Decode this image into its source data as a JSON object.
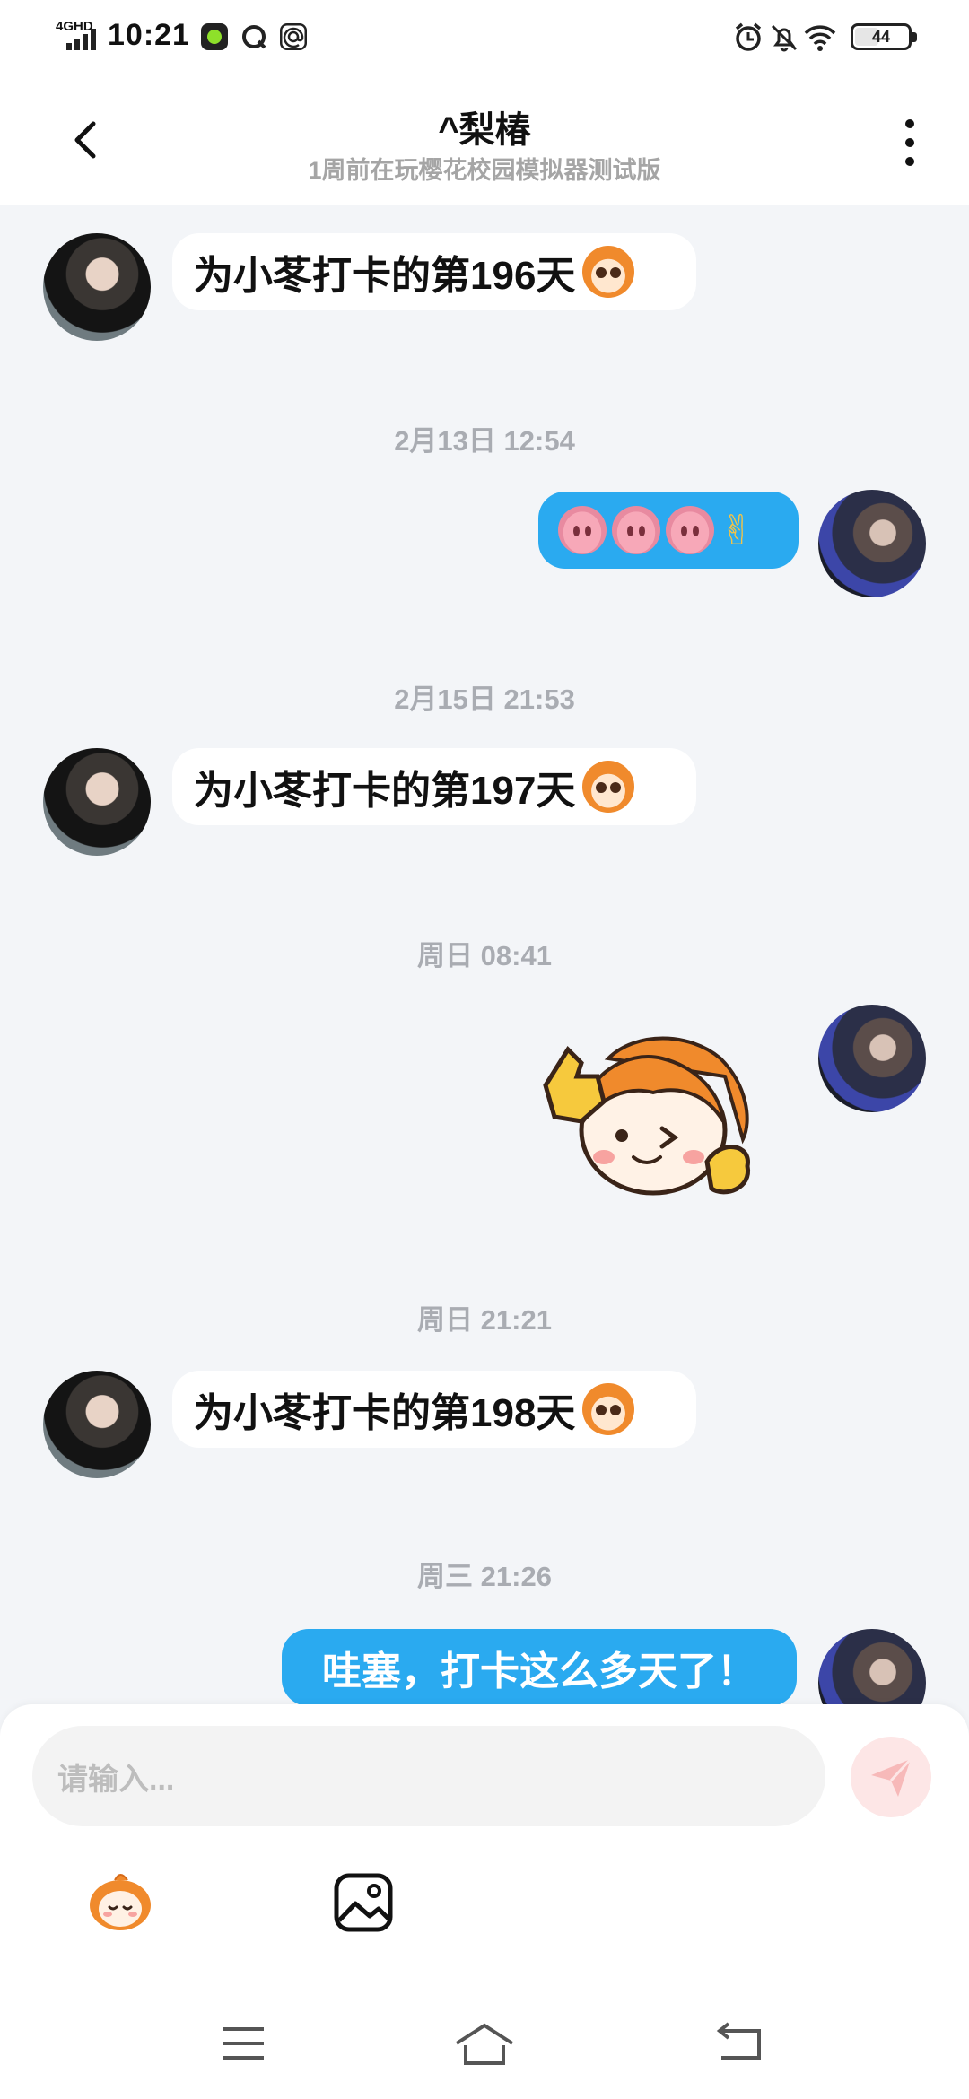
{
  "status_bar": {
    "network": "4GHD",
    "time": "10:21",
    "battery": "44",
    "battery_level": 0.44,
    "icons": [
      "app-green-icon",
      "browser-q-icon",
      "at-sign-icon",
      "alarm-icon",
      "mute-bell-icon",
      "wifi-icon",
      "battery-icon"
    ]
  },
  "header": {
    "title": "^梨椿",
    "subtitle": "1周前在玩樱花校园模拟器测试版",
    "back_icon": "chevron-left-icon",
    "more_icon": "more-vertical-icon"
  },
  "messages": [
    {
      "type": "text",
      "side": "in",
      "text": "为小苳打卡的第196天",
      "emoji": "monkey-face-emoji"
    },
    {
      "type": "timestamp",
      "text": "2月13日 12:54"
    },
    {
      "type": "emoji",
      "side": "out",
      "emojis": [
        "pig-nose-emoji",
        "pig-nose-emoji",
        "pig-nose-emoji",
        "victory-hand-emoji"
      ]
    },
    {
      "type": "timestamp",
      "text": "2月15日 21:53"
    },
    {
      "type": "text",
      "side": "in",
      "text": "为小苳打卡的第197天",
      "emoji": "monkey-face-emoji"
    },
    {
      "type": "timestamp",
      "text": "周日 08:41"
    },
    {
      "type": "sticker",
      "side": "out",
      "sticker": "cartoon-wink-thumbs-up-sticker"
    },
    {
      "type": "timestamp",
      "text": "周日 21:21"
    },
    {
      "type": "text",
      "side": "in",
      "text": "为小苳打卡的第198天",
      "emoji": "monkey-grin-emoji"
    },
    {
      "type": "timestamp",
      "text": "周三 21:26"
    },
    {
      "type": "text",
      "side": "out",
      "text": "哇塞，打卡这么多天了！"
    }
  ],
  "composer": {
    "placeholder": "请输入...",
    "send_icon": "send-plane-icon",
    "tools": [
      "emoji-sticker-icon",
      "image-icon"
    ]
  },
  "nav_bar": [
    "menu-icon",
    "home-icon",
    "back-icon"
  ],
  "colors": {
    "chat_bg": "#f3f5f8",
    "out_bubble": "#2aaaf0",
    "in_bubble": "#ffffff",
    "timestamp": "#a9acb2",
    "send_btn": "#fde6e6"
  }
}
